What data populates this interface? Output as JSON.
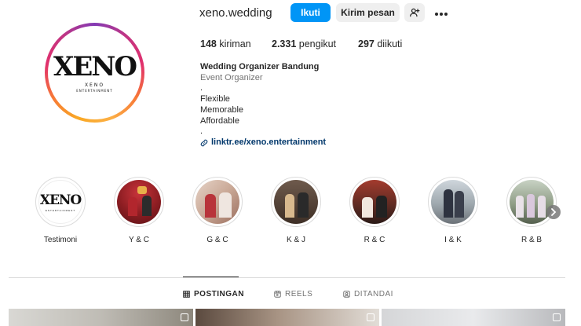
{
  "profile": {
    "username": "xeno.wedding",
    "follow_label": "Ikuti",
    "message_label": "Kirim pesan",
    "add_user_icon": "person-plus-icon",
    "more_icon": "more-icon",
    "avatar_logo": "XENO",
    "avatar_logo_sub": "XENO",
    "avatar_logo_sub2": "ENTERTAINMENT"
  },
  "stats": {
    "posts_count": "148",
    "posts_label": "kiriman",
    "followers_count": "2.331",
    "followers_label": "pengikut",
    "following_count": "297",
    "following_label": "diikuti"
  },
  "bio": {
    "name": "Wedding Organizer Bandung",
    "category": "Event Organizer",
    "dot1": ".",
    "line1": "Flexible",
    "line2": "Memorable",
    "line3": "Affordable",
    "dot2": ".",
    "link": "linktr.ee/xeno.entertainment"
  },
  "highlights": [
    {
      "label": "Testimoni"
    },
    {
      "label": "Y & C"
    },
    {
      "label": "G & C"
    },
    {
      "label": "K & J"
    },
    {
      "label": "R & C"
    },
    {
      "label": "I & K"
    },
    {
      "label": "R & B"
    }
  ],
  "tabs": {
    "posts": "POSTINGAN",
    "reels": "REELS",
    "tagged": "DITANDAI"
  },
  "colors": {
    "accent": "#0095f6",
    "link": "#00376b"
  }
}
